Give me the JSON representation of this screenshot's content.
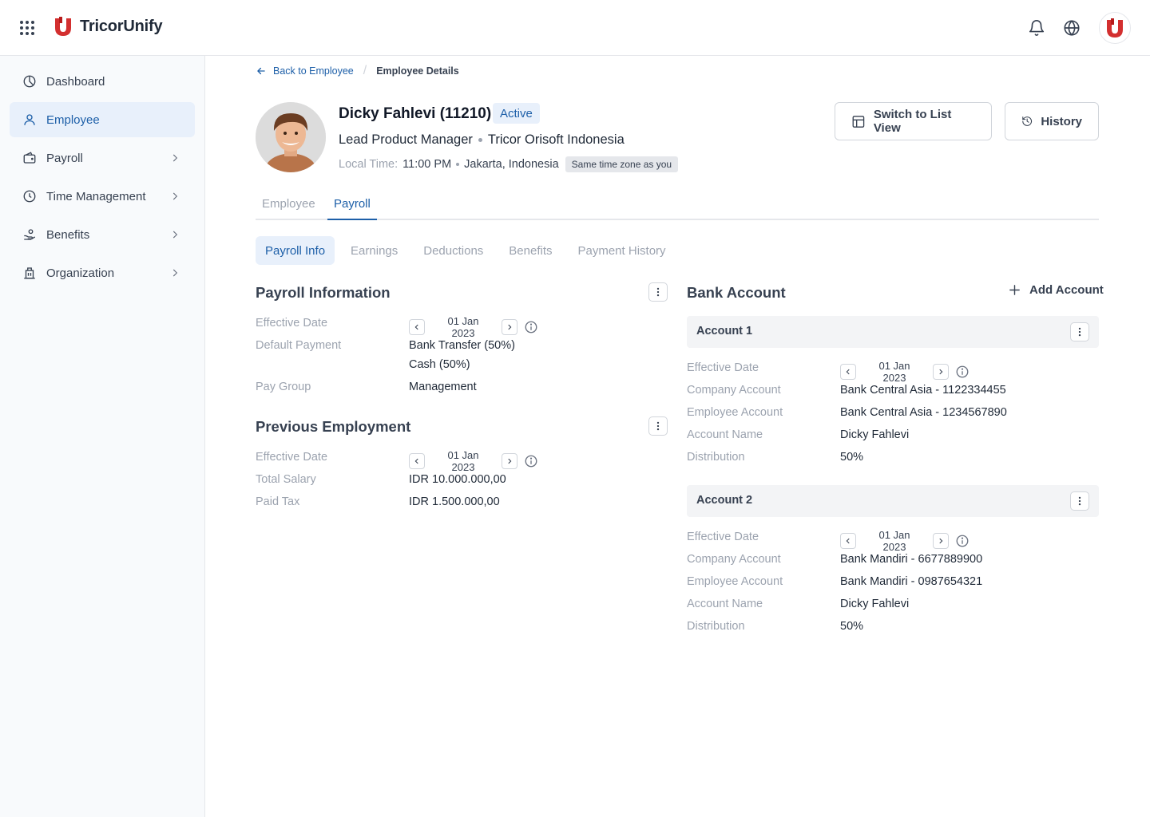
{
  "app": {
    "name": "TricorUnify",
    "brand_color": "#d32f2f",
    "accent_color": "#1d5fa8"
  },
  "sidebar": {
    "items": [
      {
        "label": "Dashboard",
        "icon": "dashboard-icon",
        "active": false
      },
      {
        "label": "Employee",
        "icon": "user-icon",
        "active": true
      },
      {
        "label": "Payroll",
        "icon": "wallet-icon",
        "active": false
      },
      {
        "label": "Time Management",
        "icon": "clock-icon",
        "active": false
      },
      {
        "label": "Benefits",
        "icon": "benefits-icon",
        "active": false
      },
      {
        "label": "Organization",
        "icon": "building-icon",
        "active": false
      }
    ]
  },
  "breadcrumb": {
    "back": "Back to Employee",
    "current": "Employee Details"
  },
  "employee": {
    "name": "Dicky Fahlevi (11210)",
    "status": "Active",
    "role": "Lead Product Manager",
    "company": "Tricor Orisoft Indonesia",
    "local_time_label": "Local Time:",
    "local_time": "11:00 PM",
    "location": "Jakarta, Indonesia",
    "timezone_badge": "Same time zone as you"
  },
  "actions": {
    "switch_view": "Switch to List View",
    "history": "History"
  },
  "tabs": [
    "Employee",
    "Payroll"
  ],
  "subtabs": [
    "Payroll Info",
    "Earnings",
    "Deductions",
    "Benefits",
    "Payment History"
  ],
  "payroll_info": {
    "title": "Payroll Information",
    "effective_date_label": "Effective Date",
    "effective_date": "01 Jan 2023",
    "default_payment_label": "Default Payment",
    "default_payment_1": "Bank Transfer (50%)",
    "default_payment_2": "Cash (50%)",
    "pay_group_label": "Pay Group",
    "pay_group": "Management"
  },
  "previous_employment": {
    "title": "Previous Employment",
    "effective_date_label": "Effective Date",
    "effective_date": "01 Jan 2023",
    "total_salary_label": "Total Salary",
    "total_salary": "IDR 10.000.000,00",
    "paid_tax_label": "Paid Tax",
    "paid_tax": "IDR 1.500.000,00"
  },
  "bank": {
    "title": "Bank Account",
    "add_label": "Add Account",
    "labels": {
      "effective_date": "Effective Date",
      "company_account": "Company Account",
      "employee_account": "Employee Account",
      "account_name": "Account Name",
      "distribution": "Distribution"
    },
    "accounts": [
      {
        "title": "Account 1",
        "effective_date": "01 Jan 2023",
        "company_account": "Bank Central Asia - 1122334455",
        "employee_account": "Bank Central Asia - 1234567890",
        "account_name": "Dicky Fahlevi",
        "distribution": "50%"
      },
      {
        "title": "Account 2",
        "effective_date": "01 Jan 2023",
        "company_account": "Bank Mandiri - 6677889900",
        "employee_account": "Bank Mandiri - 0987654321",
        "account_name": "Dicky Fahlevi",
        "distribution": "50%"
      }
    ]
  }
}
